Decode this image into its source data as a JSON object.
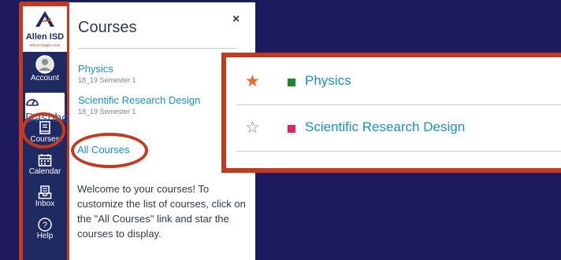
{
  "brand": {
    "name": "Allen ISD",
    "tagline": "Where Eagles Soar",
    "navy": "#1f2a63",
    "accent": "#c23a1f"
  },
  "nav": {
    "items": [
      {
        "label": "Account",
        "icon": "avatar-icon"
      },
      {
        "label": "Dashboard",
        "icon": "dashboard-gauge-icon"
      },
      {
        "label": "Courses",
        "icon": "book-icon"
      },
      {
        "label": "Calendar",
        "icon": "calendar-icon"
      },
      {
        "label": "Inbox",
        "icon": "inbox-icon"
      },
      {
        "label": "Help",
        "icon": "help-question-icon"
      }
    ]
  },
  "panel": {
    "title": "Courses",
    "close": "×",
    "courses": [
      {
        "name": "Physics",
        "term": "18_19 Semester 1"
      },
      {
        "name": "Scientific Research Design",
        "term": "18_19 Semester 1"
      }
    ],
    "all_courses": "All Courses",
    "welcome": "Welcome to your courses! To customize the list of courses, click on the \"All Courses\" link and star the courses to display."
  },
  "zoom": {
    "rows": [
      {
        "name": "Physics",
        "starred": true,
        "star": "★",
        "color": "#1e8a2c"
      },
      {
        "name": "Scientific Research Design",
        "starred": false,
        "star": "☆",
        "color": "#e0245e"
      }
    ]
  }
}
